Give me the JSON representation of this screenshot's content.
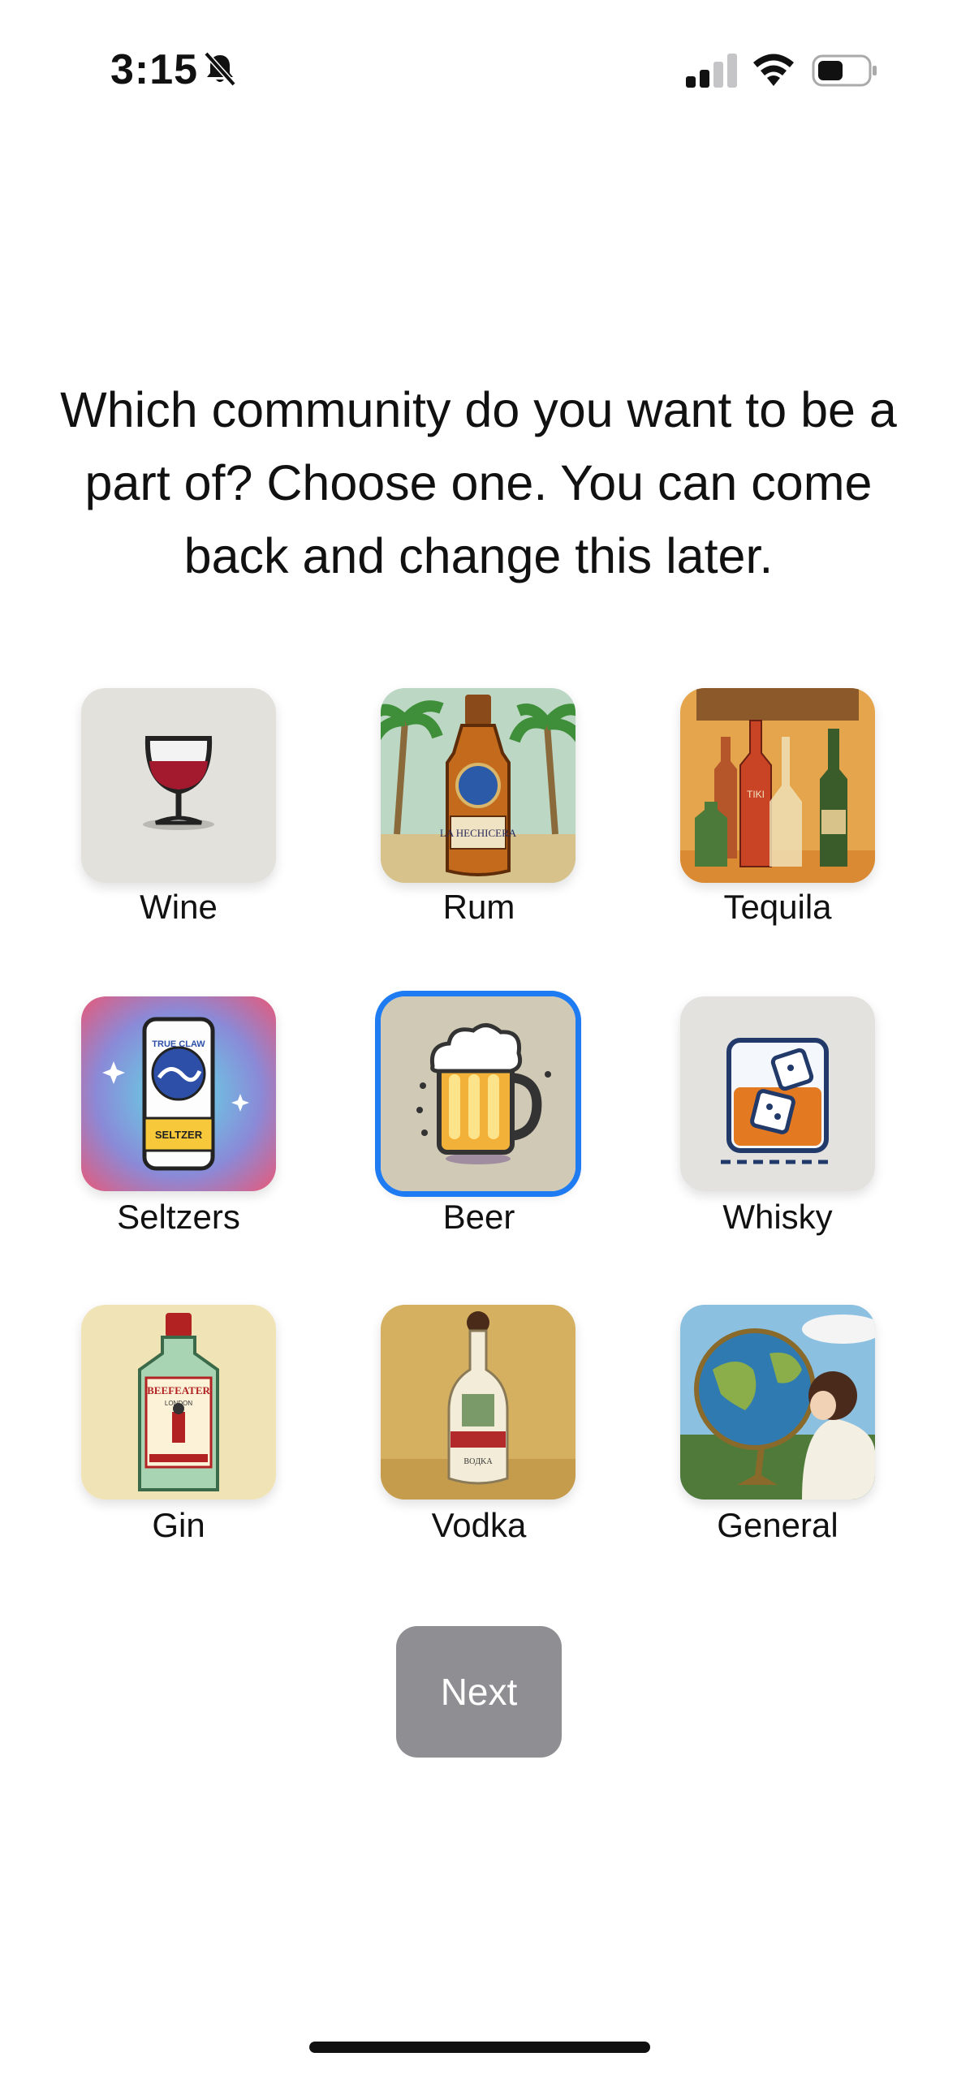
{
  "status_bar": {
    "time": "3:15",
    "icons": [
      "bell-slash-icon",
      "cellular-signal-icon",
      "wifi-icon",
      "battery-icon"
    ]
  },
  "prompt": {
    "question": "Which community do you want to be a part of? Choose one. You can come back and change this later."
  },
  "communities": [
    {
      "label": "Wine",
      "icon": "wine-glass-icon",
      "selected": false
    },
    {
      "label": "Rum",
      "icon": "rum-bottle-icon",
      "selected": false
    },
    {
      "label": "Tequila",
      "icon": "tequila-bottles-icon",
      "selected": false
    },
    {
      "label": "Seltzers",
      "icon": "seltzer-can-icon",
      "selected": false
    },
    {
      "label": "Beer",
      "icon": "beer-mug-icon",
      "selected": true
    },
    {
      "label": "Whisky",
      "icon": "whisky-glass-icon",
      "selected": false
    },
    {
      "label": "Gin",
      "icon": "gin-bottle-icon",
      "selected": false
    },
    {
      "label": "Vodka",
      "icon": "vodka-bottle-icon",
      "selected": false
    },
    {
      "label": "General",
      "icon": "globe-icon",
      "selected": false
    }
  ],
  "tile_text": {
    "rum": "LA HECHICERA",
    "tequila": "TIKI",
    "seltzer_brand": "TRUE CLAW",
    "seltzer": "SELTZER",
    "gin": "BEEFEATER",
    "gin_city": "LONDON",
    "vodka": "BOДKA"
  },
  "actions": {
    "next_label": "Next"
  },
  "colors": {
    "accent_selected": "#1e7bf2",
    "next_button_bg": "#8e8e93"
  }
}
